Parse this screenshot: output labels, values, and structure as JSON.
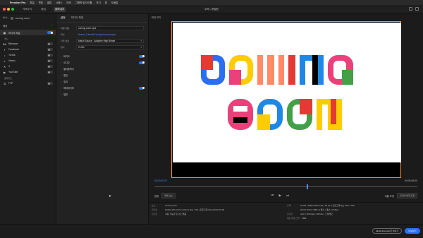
{
  "menubar": {
    "app": "Premiere Pro",
    "items": [
      "파일",
      "편집",
      "클립",
      "시퀀스",
      "마커",
      "그래픽 및 타이틀",
      "보기",
      "창",
      "도움말"
    ],
    "clock": "10월 17일 (목) 오후 2:56"
  },
  "header": {
    "tabs": [
      "가져오기",
      "편집",
      "내보내기"
    ],
    "active_tab": 2,
    "project_title": "무제 - 편집됨"
  },
  "left_panel": {
    "source_label": "소스:",
    "source_name": "coming soon",
    "section": "대상",
    "items": [
      {
        "label": "미디어 파일",
        "icon": "film-icon",
        "on": true,
        "selected": true
      }
    ],
    "social_label": "게시",
    "social": [
      {
        "label": "Behance",
        "icon": "behance-icon",
        "on": false
      },
      {
        "label": "Facebook",
        "icon": "facebook-icon",
        "on": false
      },
      {
        "label": "TikTok",
        "icon": "tiktok-icon",
        "on": false
      },
      {
        "label": "Vimeo",
        "icon": "vimeo-icon",
        "on": false
      },
      {
        "label": "X",
        "icon": "x-icon",
        "on": false
      },
      {
        "label": "YouTube",
        "icon": "youtube-icon",
        "on": false
      }
    ],
    "other_label": "클라우드",
    "other": [
      {
        "label": "FTP",
        "icon": "ftp-icon",
        "on": false
      }
    ]
  },
  "mid_panel": {
    "tabs": [
      "설정",
      "미디어 파일"
    ],
    "file_name_label": "파일 이름",
    "file_name": "coming soon.mp4",
    "location_label": "위치",
    "location": "/Users/_Tutorial/Coming Home project",
    "preset_label": "사전 설정",
    "preset": "Match Source - Adaptive High Bitrate",
    "format_label": "형식",
    "format": "H.264",
    "sections": [
      {
        "label": "비디오",
        "on": true
      },
      {
        "label": "오디오",
        "on": true
      },
      {
        "label": "멀티플렉서",
        "on": false
      },
      {
        "label": "캡션",
        "on": false
      },
      {
        "label": "효과",
        "on": false
      },
      {
        "label": "메타데이터",
        "on": true
      },
      {
        "label": "일반",
        "on": false
      }
    ]
  },
  "preview": {
    "title": "미리 보기",
    "timecode_in": "00:00:03:22",
    "timecode_out": "00:00:05:00",
    "range_label": "범위",
    "range_value": "전체 소스",
    "scale_label": "비율 조정",
    "scale_value": "크기에 맞게 조정",
    "playhead_pct": 0.58
  },
  "summary": {
    "source_label": "소스:",
    "source_name": "coming soon",
    "video_label": "비디오",
    "video": "1920x1200 (1.0) | 24 fps | Rec. 709 | 프로그레시브 | 00:00:10:00",
    "audio_label": "오디오",
    "audio": "사용 가능한 오디오 없음",
    "output_label": "출력",
    "out_video": "H.264 | 1920x1200 (1.0) | 24 fps | 프로그레시브 | Rec. 709",
    "out_hw": "00:00:10:00 | VBR | 1패스 | 대상 12 Mbps",
    "out_audio_label": "오디오",
    "out_audio": "AAC | 320 kbps | 48 kHz | 스테레오",
    "size_label": "예상 파일 크기",
    "size": "2MB"
  },
  "bottom": {
    "media_encoder": "Media Encoder로 보내기",
    "export": "내보내기"
  },
  "colors": {
    "accent": "#2a6ef2",
    "preview_border": "#f08a3c"
  }
}
